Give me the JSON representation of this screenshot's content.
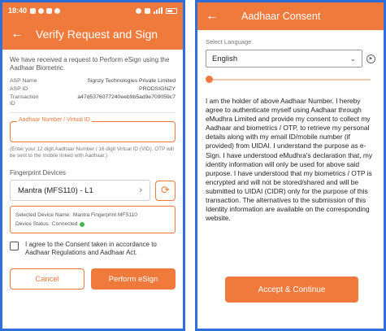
{
  "left": {
    "status_bar": {
      "time": "18:40"
    },
    "appbar": {
      "back_glyph": "←",
      "title": "Verify Request and Sign"
    },
    "intro": "We have received a request to Perform eSign using the Aadhaar Biometric.",
    "details": [
      {
        "label": "ASP Name",
        "value": "Signzy Technologies Private Limited"
      },
      {
        "label": "ASP ID",
        "value": "PRODSIGNZY"
      },
      {
        "label": "Transaction ID",
        "value": "a47d537607724​0eeb9b5ad9e709059c7"
      }
    ],
    "aadhaar_field": {
      "label": "Aadhaar Number / Virtual ID",
      "value": ""
    },
    "hint": "(Enter your 12 digit Aadhaar Number / 16 digit Virtual ID (VID). OTP will be sent to the mobile linked with Aadhaar.)",
    "fingerprint_label": "Fingerprint Devices",
    "device_selected": "Mantra (MFS110) - L1",
    "device_info": {
      "name_label": "Selected Device Name:",
      "name_value": "Mantra Fingerprint MFS110",
      "status_label": "Device Status:",
      "status_value": "Connected",
      "status_color": "#49b847"
    },
    "consent_text": "I agree to the Consent taken in accordance to Aadhaar Regulations and Aadhaar Act.",
    "cancel_label": "Cancel",
    "perform_label": "Perform eSign"
  },
  "right": {
    "appbar": {
      "back_glyph": "←",
      "title": "Aadhaar Consent"
    },
    "select_language_label": "Select Language",
    "language": "English",
    "consent_paragraph": "I am the holder of above Aadhaar Number. I hereby agree to authenticate myself using Aadhaar through eMudhra Limited and provide my consent to collect my Aadhaar and biometrics / OTP, to retrieve my personal details along with my email ID/mobile number (if provided) from UIDAI. I understand the purpose as e-Sign. I have understood eMudhra's declaration that, my identity information will only be used for above said purpose. I have understood that my biometrics / OTP is encrypted and will not be stored/shared and will be submitted to UIDAI (CIDR) only for the purpose of this transaction. The alternatives to the submission of this Identity information are available on the corresponding website.",
    "accept_label": "Accept & Continue",
    "audio_progress": 0.0
  },
  "colors": {
    "accent": "#ef7a3c",
    "frame": "#2e6fdc"
  }
}
